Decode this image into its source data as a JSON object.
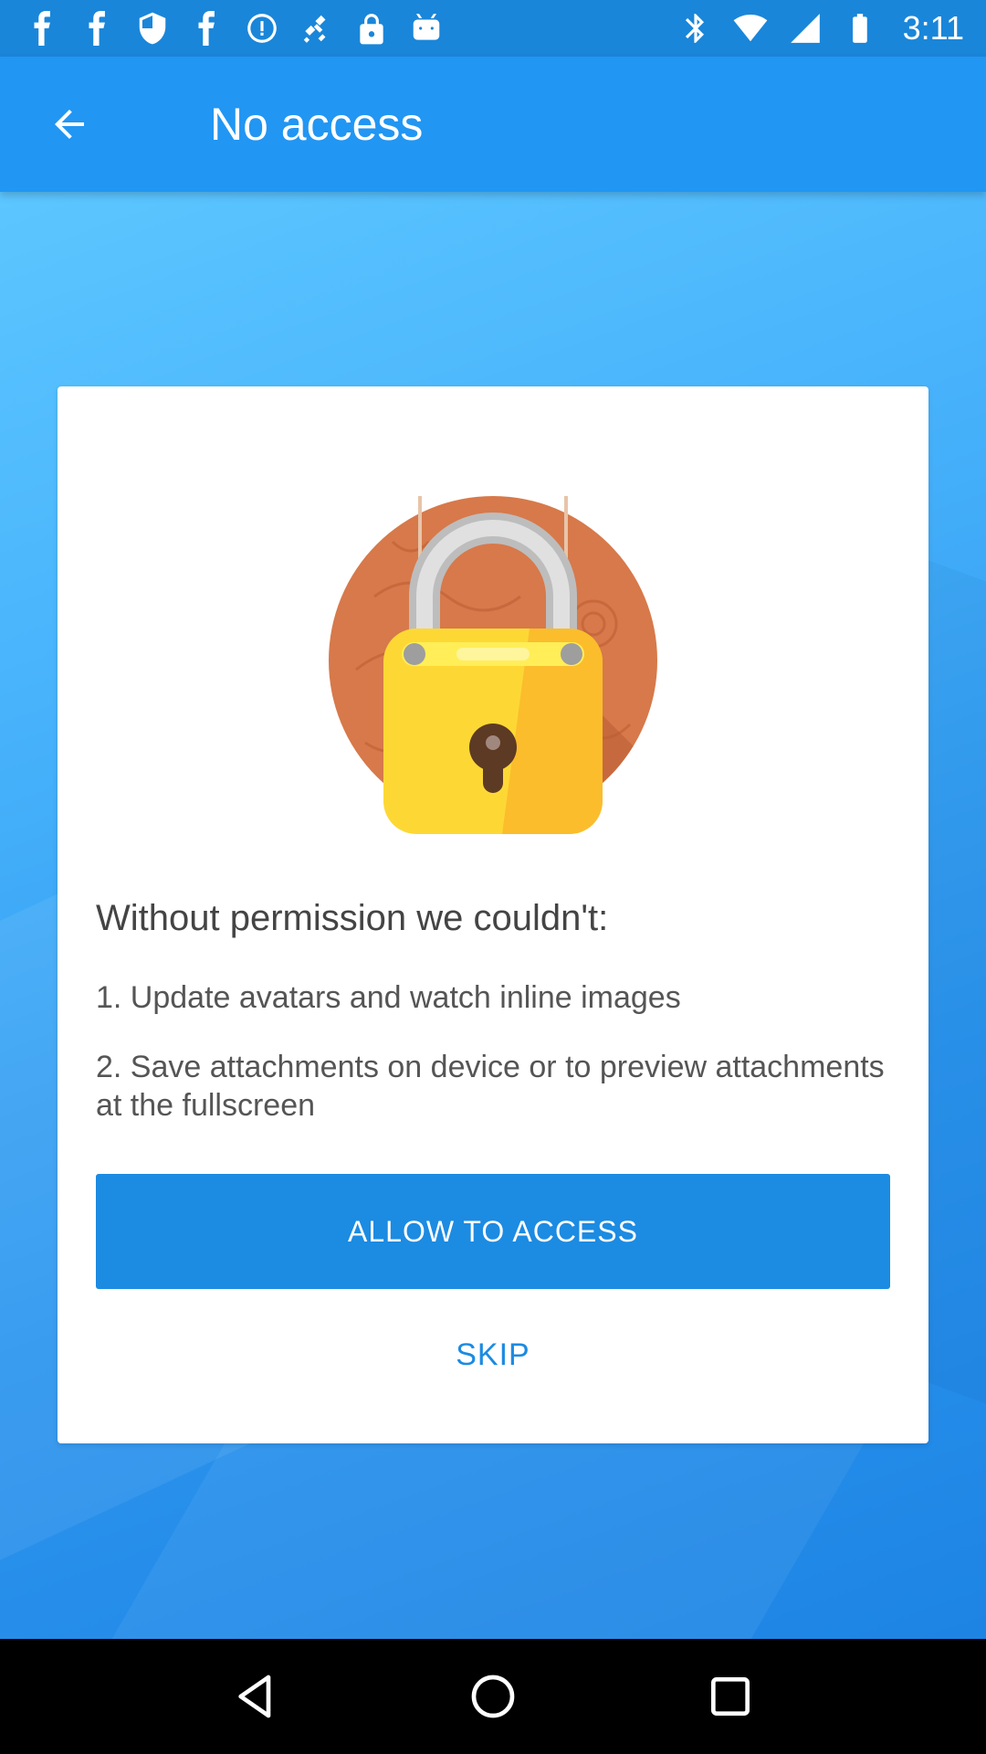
{
  "status_bar": {
    "time": "3:11",
    "icons_left": [
      "facebook-icon",
      "facebook-icon",
      "shield-icon",
      "facebook-icon",
      "data-saver-icon",
      "fake-gps-icon",
      "lock-icon",
      "android-icon"
    ],
    "icons_right": [
      "bluetooth-icon",
      "wifi-icon",
      "signal-icon",
      "battery-icon"
    ]
  },
  "app_bar": {
    "title": "No access",
    "back_icon": "arrow-back-icon"
  },
  "card": {
    "illustration": "padlock-icon",
    "heading": "Without permission we couldn't:",
    "items": [
      "1. Update avatars and watch inline images",
      "2. Save attachments on device or to preview attachments at the fullscreen"
    ],
    "allow_button": "ALLOW TO ACCESS",
    "skip_button": "SKIP"
  },
  "nav_bar": {
    "icons": [
      "back-triangle-icon",
      "home-circle-icon",
      "recents-square-icon"
    ]
  },
  "colors": {
    "status_bar": "#1a86d9",
    "app_bar": "#2196f3",
    "accent": "#1c8be2",
    "card": "#ffffff"
  }
}
